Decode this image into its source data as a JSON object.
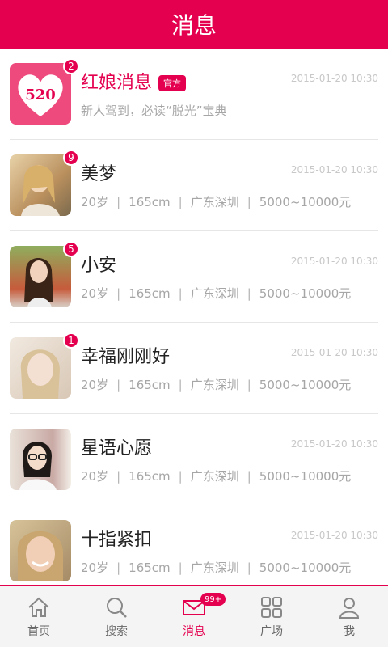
{
  "header": {
    "title": "消息"
  },
  "messages": [
    {
      "name": "红娘消息",
      "tag": "官方",
      "time": "2015-01-20  10:30",
      "badge": "2",
      "subtitle": "新人驾到，必读“脱光”宝典",
      "avatar_text": "520",
      "official": true
    },
    {
      "name": "美梦",
      "time": "2015-01-20  10:30",
      "badge": "9",
      "details": [
        "20岁",
        "165cm",
        "广东深圳",
        "5000~10000元"
      ]
    },
    {
      "name": "小安",
      "time": "2015-01-20  10:30",
      "badge": "5",
      "details": [
        "20岁",
        "165cm",
        "广东深圳",
        "5000~10000元"
      ]
    },
    {
      "name": "幸福刚刚好",
      "time": "2015-01-20  10:30",
      "badge": "1",
      "details": [
        "20岁",
        "165cm",
        "广东深圳",
        "5000~10000元"
      ]
    },
    {
      "name": "星语心愿",
      "time": "2015-01-20  10:30",
      "details": [
        "20岁",
        "165cm",
        "广东深圳",
        "5000~10000元"
      ]
    },
    {
      "name": "十指紧扣",
      "time": "2015-01-20  10:30",
      "details": [
        "20岁",
        "165cm",
        "广东深圳",
        "5000~10000元"
      ]
    }
  ],
  "tabs": [
    {
      "label": "首页",
      "icon": "home-icon"
    },
    {
      "label": "搜索",
      "icon": "search-icon"
    },
    {
      "label": "消息",
      "icon": "mail-icon",
      "badge": "99+",
      "active": true
    },
    {
      "label": "广场",
      "icon": "grid-icon"
    },
    {
      "label": "我",
      "icon": "user-icon"
    }
  ],
  "colors": {
    "brand": "#e4004f"
  }
}
